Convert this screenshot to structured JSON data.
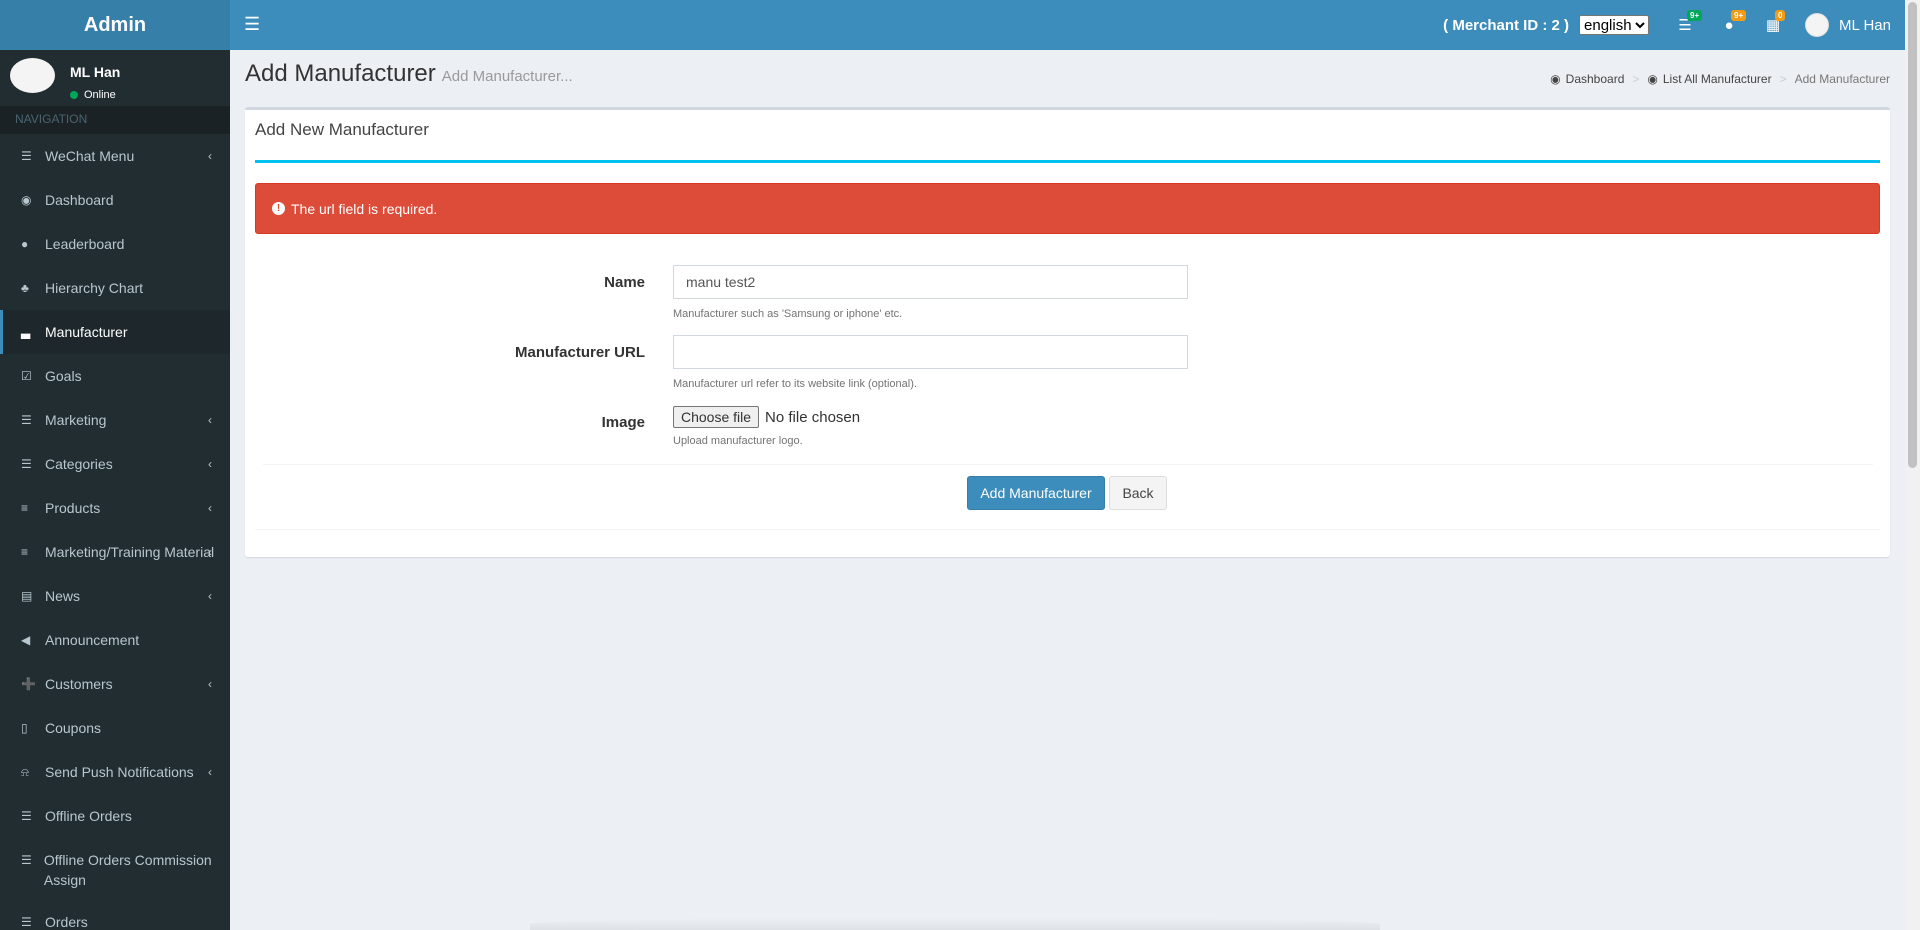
{
  "brand": "Admin",
  "topbar": {
    "merchant": "( Merchant ID : 2 )",
    "language": "english",
    "languages": [
      "english"
    ],
    "badges": {
      "tasks": "9+",
      "users": "9+",
      "apps": "0"
    },
    "user": "ML Han"
  },
  "sidebar": {
    "user_name": "ML Han",
    "status": "Online",
    "nav_header": "NAVIGATION",
    "items": [
      {
        "label": "WeChat Menu",
        "icon": "bars-icon",
        "chevron": "‹"
      },
      {
        "label": "Dashboard",
        "icon": "dashboard-icon",
        "chevron": ""
      },
      {
        "label": "Leaderboard",
        "icon": "users-icon",
        "chevron": ""
      },
      {
        "label": "Hierarchy Chart",
        "icon": "tree-icon",
        "chevron": ""
      },
      {
        "label": "Manufacturer",
        "icon": "industry-icon",
        "chevron": ""
      },
      {
        "label": "Goals",
        "icon": "check-square-icon",
        "chevron": ""
      },
      {
        "label": "Marketing",
        "icon": "bars-icon",
        "chevron": "‹"
      },
      {
        "label": "Categories",
        "icon": "bars-icon",
        "chevron": "‹"
      },
      {
        "label": "Products",
        "icon": "database-icon",
        "chevron": "‹"
      },
      {
        "label": "Marketing/Training Material",
        "icon": "database-icon",
        "chevron": "‹"
      },
      {
        "label": "News",
        "icon": "newspaper-icon",
        "chevron": "‹"
      },
      {
        "label": "Announcement",
        "icon": "volume-icon",
        "chevron": ""
      },
      {
        "label": "Customers",
        "icon": "user-plus-icon",
        "chevron": "‹"
      },
      {
        "label": "Coupons",
        "icon": "tablet-icon",
        "chevron": ""
      },
      {
        "label": "Send Push Notifications",
        "icon": "bell-icon",
        "chevron": "‹"
      },
      {
        "label": "Offline Orders",
        "icon": "list-icon",
        "chevron": ""
      },
      {
        "label": "Offline Orders Commission Assign",
        "icon": "list-icon",
        "chevron": ""
      },
      {
        "label": "Orders",
        "icon": "list-icon",
        "chevron": ""
      }
    ]
  },
  "header": {
    "title": "Add Manufacturer",
    "subtitle": "Add Manufacturer...",
    "breadcrumb": [
      "Dashboard",
      "List All Manufacturer",
      "Add Manufacturer"
    ]
  },
  "form": {
    "box_title": "Add New Manufacturer",
    "error": "The url field is required.",
    "name_label": "Name",
    "name_value": "manu test2",
    "name_help": "Manufacturer such as 'Samsung or iphone' etc.",
    "url_label": "Manufacturer URL",
    "url_value": "",
    "url_help": "Manufacturer url refer to its website link (optional).",
    "image_label": "Image",
    "file_button": "Choose file",
    "file_status": "No file chosen",
    "image_help": "Upload manufacturer logo.",
    "submit": "Add Manufacturer",
    "back": "Back"
  }
}
